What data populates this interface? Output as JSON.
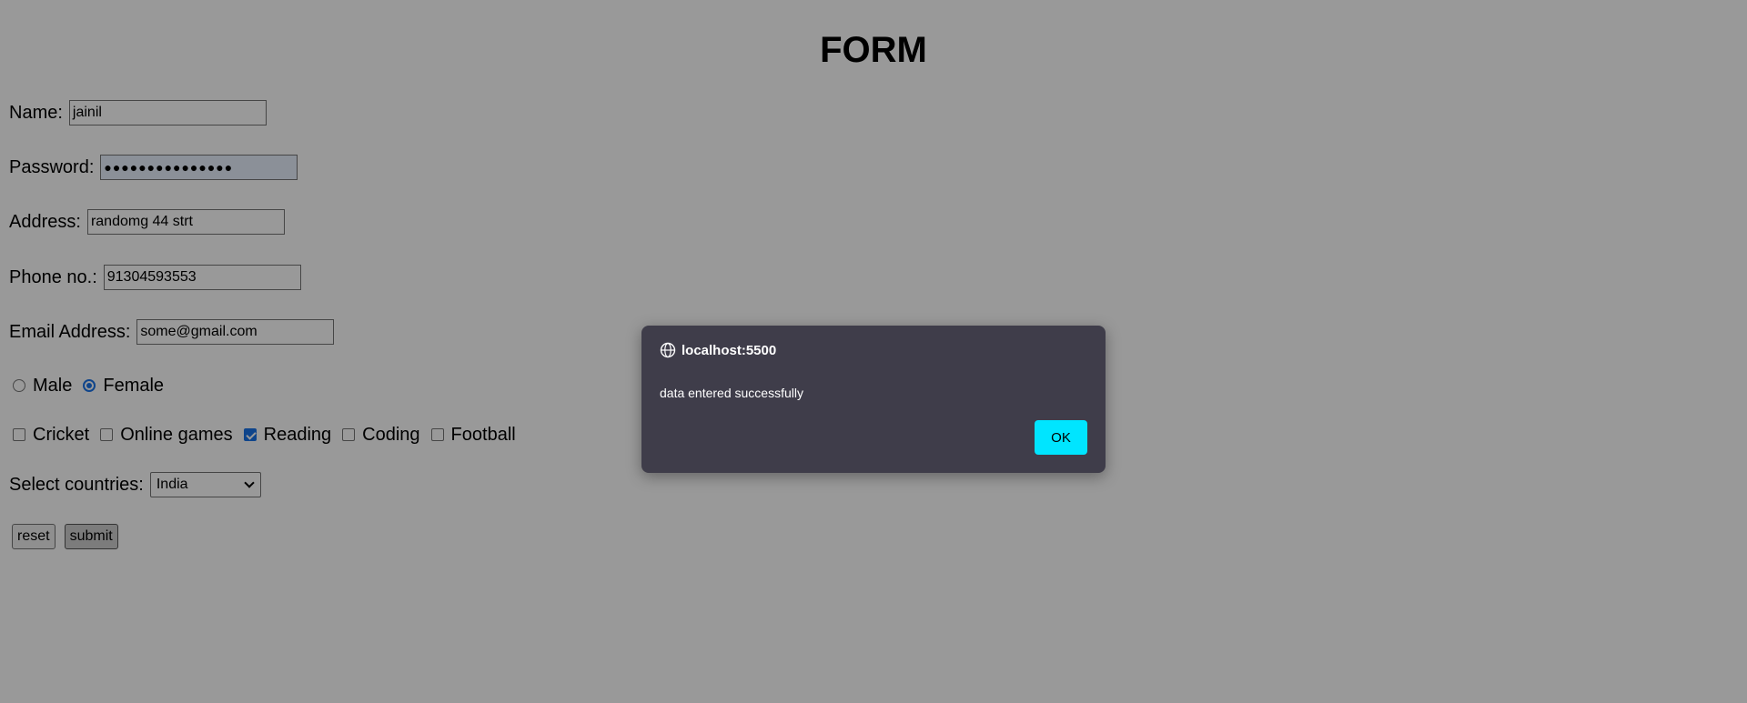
{
  "form": {
    "title": "FORM",
    "name": {
      "label": "Name:",
      "value": "jainil"
    },
    "password": {
      "label": "Password:",
      "value": "●●●●●●●●●●●●●●●"
    },
    "address": {
      "label": "Address:",
      "value": "randomg 44 strt"
    },
    "phone": {
      "label": "Phone no.:",
      "value": "91304593553"
    },
    "email": {
      "label": "Email Address:",
      "value": "some@gmail.com"
    },
    "gender": {
      "options": [
        {
          "label": "Male",
          "selected": false
        },
        {
          "label": "Female",
          "selected": true
        }
      ]
    },
    "hobbies": [
      {
        "label": "Cricket",
        "checked": false
      },
      {
        "label": "Online games",
        "checked": false
      },
      {
        "label": "Reading",
        "checked": true
      },
      {
        "label": "Coding",
        "checked": false
      },
      {
        "label": "Football",
        "checked": false
      }
    ],
    "country": {
      "label": "Select countries:",
      "selected": "India"
    },
    "buttons": {
      "reset": "reset",
      "submit": "submit"
    }
  },
  "dialog": {
    "origin": "localhost:5500",
    "message": "data entered successfully",
    "ok_label": "OK",
    "icon": "globe-icon"
  },
  "colors": {
    "dialog_bg": "#3f3d4a",
    "ok_button": "#00e5ff",
    "accent": "#1a73e8",
    "overlay": "rgba(0,0,0,0.40)"
  }
}
